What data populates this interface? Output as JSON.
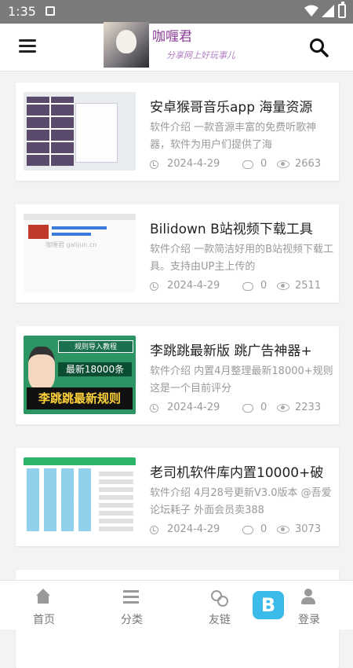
{
  "status_bar": {
    "time": "1:35",
    "icons": [
      "sim-icon",
      "wifi-icon",
      "signal-icon",
      "battery-icon"
    ]
  },
  "header": {
    "menu_icon": "hamburger-icon",
    "search_icon": "search-icon",
    "logo_title": "咖喱君",
    "logo_slogan": "分享网上好玩事儿"
  },
  "posts": [
    {
      "title": "安卓猴哥音乐app 海量资源",
      "excerpt": "软件介绍 一款音源丰富的免费听歌神器，软件为用户们提供了海",
      "date": "2024-4-29",
      "comments": "0",
      "views": "2663"
    },
    {
      "title": "Bilidown B站视频下载工具",
      "excerpt": "软件介绍 一款简洁好用的B站视频下载工具。支持由UP主上传的",
      "date": "2024-4-29",
      "comments": "0",
      "views": "2511",
      "thumb_text": "咖喱君 galijun.cn"
    },
    {
      "title": "李跳跳最新版 跳广告神器+",
      "excerpt": "软件介绍 内置4月整理最新18000+规则 这是一个目前评分",
      "date": "2024-4-29",
      "comments": "0",
      "views": "2233",
      "thumb_lines": [
        "规则导入教程",
        "最新18000条",
        "李跳跳最新规则"
      ]
    },
    {
      "title": "老司机软件库内置10000+破",
      "excerpt": "软件介绍 4月28号更新V3.0版本 @吾爱论坛耗子 外面会员卖388",
      "date": "2024-4-29",
      "comments": "0",
      "views": "3073"
    }
  ],
  "tabbar": {
    "items": [
      {
        "label": "首页",
        "icon": "home-icon"
      },
      {
        "label": "分类",
        "icon": "list-icon"
      },
      {
        "label": "友链",
        "icon": "link-icon"
      },
      {
        "label": "登录",
        "icon": "user-icon"
      }
    ]
  },
  "colors": {
    "status_bar": "#7a7a7a",
    "background": "#f3f3f3",
    "logo_purple": "#8a3e98",
    "muted_text": "#9a9a9a"
  }
}
